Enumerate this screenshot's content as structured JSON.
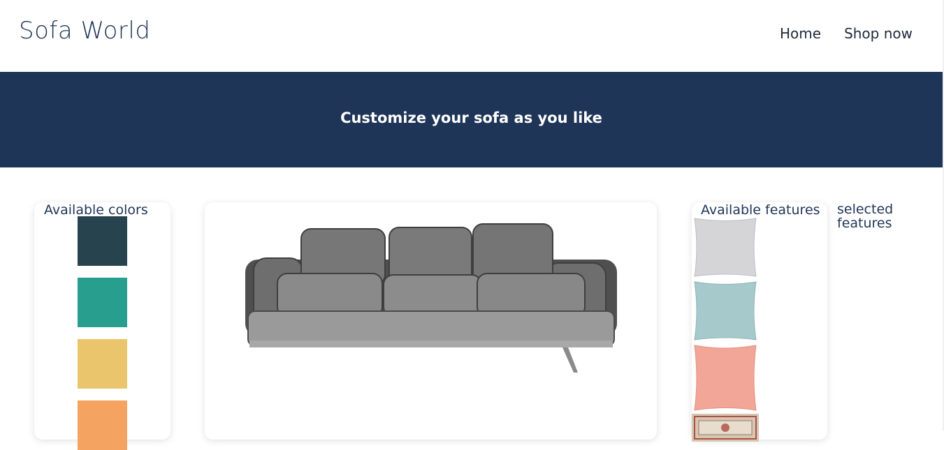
{
  "header": {
    "brand": "Sofa World",
    "nav": {
      "home": "Home",
      "shop_now": "Shop now"
    }
  },
  "banner": {
    "title": "Customize your sofa as you like"
  },
  "colors": {
    "title": "Available colors",
    "swatches": [
      "#27434e",
      "#289f8e",
      "#eac56c",
      "#f4a361"
    ]
  },
  "preview": {
    "image": "grey-leather-sofa"
  },
  "features": {
    "title": "Available features",
    "items": [
      {
        "name": "white-pillow",
        "color": "#d5d5d8"
      },
      {
        "name": "light-blue-pillow",
        "color": "#a6c9cb"
      },
      {
        "name": "peach-pillow",
        "color": "#f2a698"
      },
      {
        "name": "patterned-rug",
        "color": "#d9c5b0"
      }
    ]
  },
  "selected": {
    "title": "selected features"
  }
}
